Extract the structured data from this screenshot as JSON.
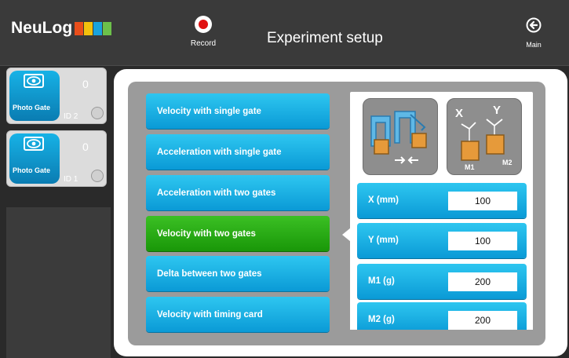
{
  "header": {
    "logo_text": "NeuLog",
    "logo_colors": [
      "#e94e1b",
      "#f3c10d",
      "#1aa3dc",
      "#6cc04a"
    ],
    "record_label": "Record",
    "title": "Experiment setup",
    "main_label": "Main"
  },
  "sensors": [
    {
      "name": "Photo Gate",
      "id": "ID 2",
      "value": "0"
    },
    {
      "name": "Photo Gate",
      "id": "ID 1",
      "value": "0"
    }
  ],
  "options": [
    {
      "label": "Velocity with single gate",
      "selected": false
    },
    {
      "label": "Acceleration with single gate",
      "selected": false
    },
    {
      "label": "Acceleration with two gates",
      "selected": false
    },
    {
      "label": "Velocity with two gates",
      "selected": true
    },
    {
      "label": "Delta between two gates",
      "selected": false
    },
    {
      "label": "Velocity with timing card",
      "selected": false
    }
  ],
  "diagram_labels": {
    "x": "X",
    "y": "Y",
    "m1": "M1",
    "m2": "M2"
  },
  "fields": [
    {
      "label": "X (mm)",
      "value": "100"
    },
    {
      "label": "Y (mm)",
      "value": "100"
    },
    {
      "label": "M1 (g)",
      "value": "200"
    },
    {
      "label": "M2 (g)",
      "value": "200"
    }
  ],
  "colors": {
    "accent_blue": "#17b2e6",
    "selected_green": "#2aa715",
    "record_red": "#e01010"
  }
}
